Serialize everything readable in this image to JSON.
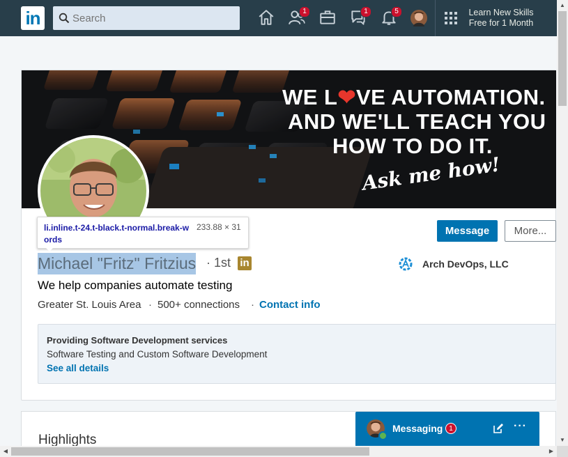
{
  "nav": {
    "logo_text": "in",
    "search_placeholder": "Search",
    "badges": {
      "network": "1",
      "messaging": "1",
      "notifications": "5"
    },
    "promo_line1": "Learn New Skills",
    "promo_line2": "Free for 1 Month"
  },
  "banner": {
    "line1_a": "WE L",
    "line1_b": "VE AUTOMATION.",
    "line2": "AND WE'LL TEACH YOU",
    "line3": "HOW TO DO IT.",
    "tagline": "Ask me how!"
  },
  "tooltip": {
    "selector": "li.inline.t-24.t-black.t-normal.break-words",
    "size": "233.88 × 31"
  },
  "profile": {
    "name": "Michael \"Fritz\" Fritzius",
    "degree": "· 1st",
    "badge": "in",
    "headline": "We help companies automate testing",
    "location": "Greater St. Louis Area",
    "separator": "·",
    "connections": "500+ connections",
    "contact": "Contact info",
    "company": "Arch DevOps, LLC"
  },
  "actions": {
    "message": "Message",
    "more": "More..."
  },
  "services": {
    "title": "Providing Software Development services",
    "description": "Software Testing and Custom Software Development",
    "link": "See all details"
  },
  "highlights": {
    "title": "Highlights"
  },
  "messaging": {
    "label": "Messaging",
    "count": "1",
    "more": "···"
  },
  "colors": {
    "nav_bg": "#283e4a",
    "primary": "#0073b1",
    "badge": "#cb112d",
    "name_highlight": "#a7c6e5"
  }
}
